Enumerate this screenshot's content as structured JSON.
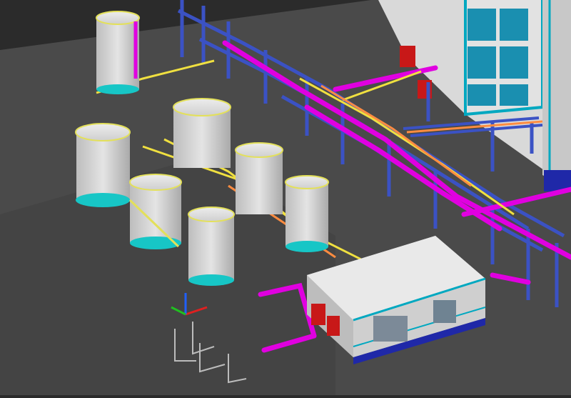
{
  "scene": {
    "type": "3D isometric plant model",
    "background": "#2b2b2b",
    "ground": "#4a4a4a",
    "colors": {
      "tank_body": "#cfcfcf",
      "tank_band": "#17c6c6",
      "railing": "#e3e05a",
      "pipe_magenta": "#e000e0",
      "pipe_yellow": "#f0e040",
      "pipe_orange": "#ff8c40",
      "steel_blue": "#3b52c4",
      "building_wall": "#d7d7d7",
      "building_frame": "#00a8c0",
      "door_red": "#c81818"
    },
    "icons": [
      "storage-tank-icon",
      "pipe-rack-icon",
      "building-icon",
      "ucs-axis-icon"
    ]
  }
}
